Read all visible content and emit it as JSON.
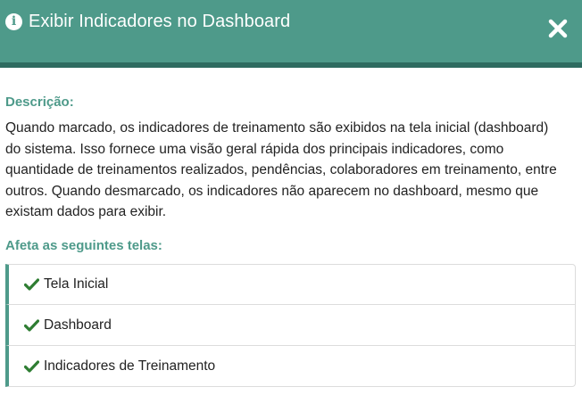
{
  "header": {
    "icon": "info-circle-icon",
    "title": "Exibir Indicadores no Dashboard",
    "close_icon": "close-icon",
    "background_color": "#4e9a8a"
  },
  "body": {
    "description_label": "Descrição:",
    "description_text": "Quando marcado, os indicadores de treinamento são exibidos na tela inicial (dashboard) do sistema. Isso fornece uma visão geral rápida dos principais indicadores, como quantidade de treinamentos realizados, pendências, colaboradores em treinamento, entre outros. Quando desmarcado, os indicadores não aparecem no dashboard, mesmo que existam dados para exibir.",
    "screens_label": "Afeta as seguintes telas:",
    "screens": [
      {
        "icon": "check-icon",
        "label": "Tela Inicial"
      },
      {
        "icon": "check-icon",
        "label": "Dashboard"
      },
      {
        "icon": "check-icon",
        "label": "Indicadores de Treinamento"
      }
    ],
    "check_color": "#2e7d32"
  }
}
